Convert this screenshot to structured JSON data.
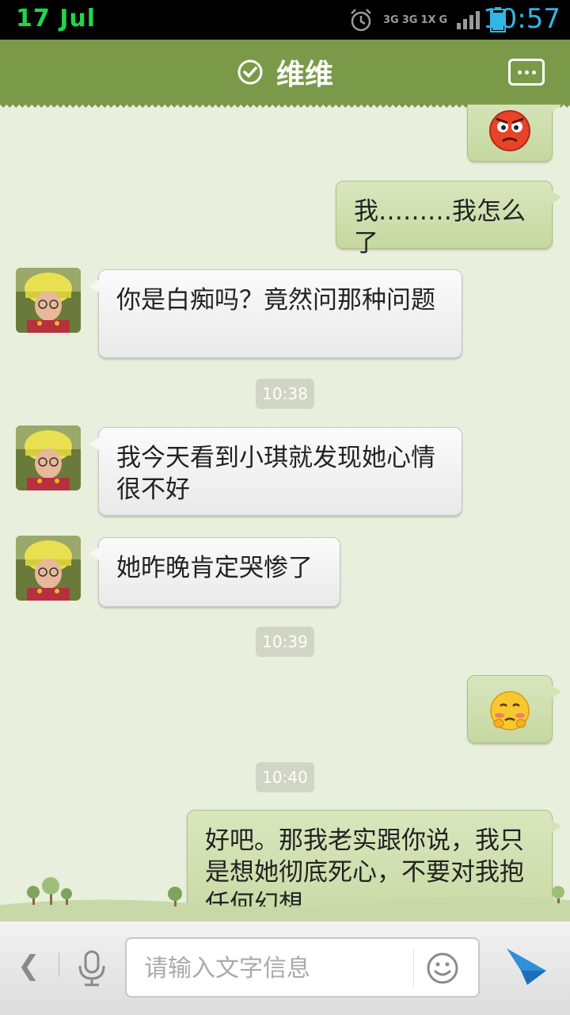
{
  "status_bar": {
    "date": "17  Jul",
    "time": "10:57",
    "network_labels": [
      "3G",
      "3G",
      "1X",
      "G"
    ]
  },
  "header": {
    "contact_name": "维维",
    "verified_icon": "check-circle-icon",
    "menu_icon": "more-icon"
  },
  "messages": [
    {
      "side": "right",
      "type": "emoji",
      "emoji": "angry-face-icon"
    },
    {
      "side": "right",
      "type": "text",
      "text": "我………我怎么了"
    },
    {
      "side": "left",
      "type": "text",
      "text": "你是白痴吗？竟然问那种问题"
    },
    {
      "type": "timestamp",
      "text": "10:38"
    },
    {
      "side": "left",
      "type": "text",
      "text": "我今天看到小琪就发现她心情很不好"
    },
    {
      "side": "left",
      "type": "text",
      "text": "她昨晚肯定哭惨了"
    },
    {
      "type": "timestamp",
      "text": "10:39"
    },
    {
      "side": "right",
      "type": "emoji",
      "emoji": "embarrassed-face-icon"
    },
    {
      "type": "timestamp",
      "text": "10:40"
    },
    {
      "side": "right",
      "type": "text",
      "text": "好吧。那我老实跟你说，我只是想她彻底死心，不要对我抱任何幻想"
    }
  ],
  "input_bar": {
    "placeholder": "请输入文字信息",
    "value": ""
  },
  "colors": {
    "header_bg": "#7a9a4a",
    "chat_bg": "#e8efdc",
    "outgoing_bubble": "#c6d8a0",
    "incoming_bubble": "#f2f2f2",
    "send_icon": "#2f8fd8"
  }
}
